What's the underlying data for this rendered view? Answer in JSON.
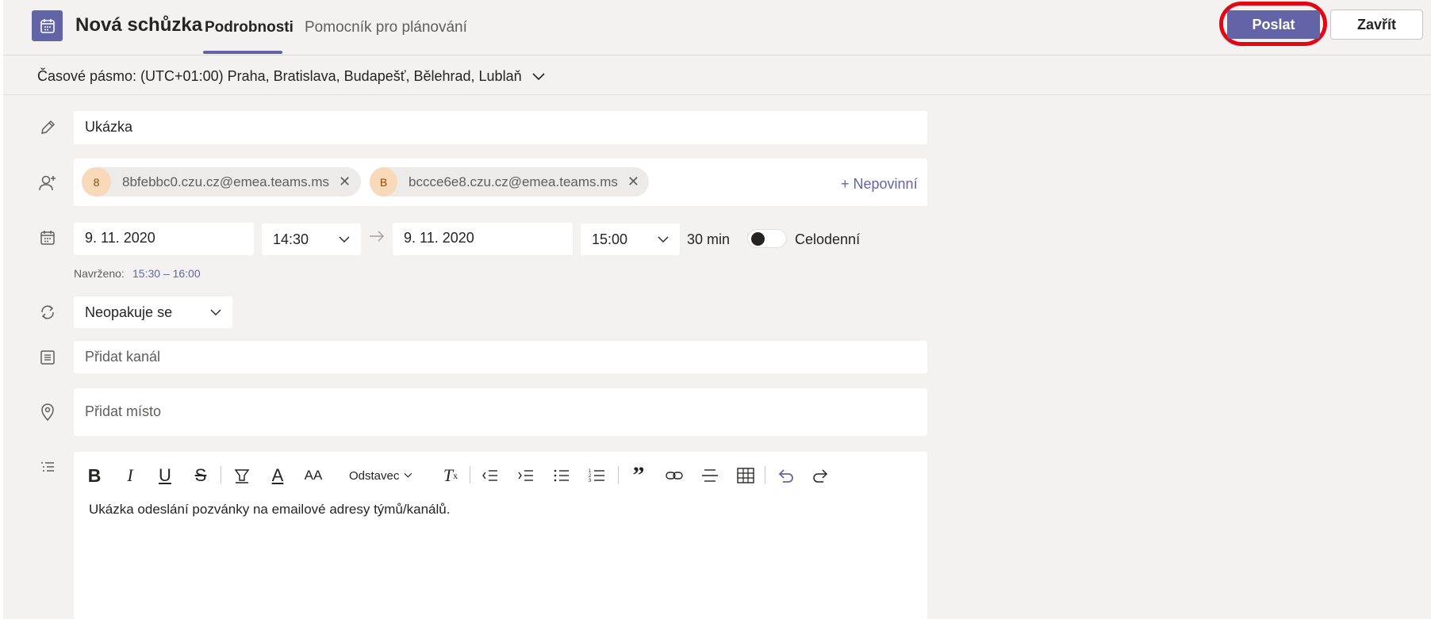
{
  "header": {
    "title": "Nová schůzka",
    "tabs": [
      {
        "label": "Podrobnosti",
        "active": true
      },
      {
        "label": "Pomocník pro plánování",
        "active": false
      }
    ],
    "send_label": "Poslat",
    "close_label": "Zavřít"
  },
  "timezone": {
    "label": "Časové pásmo: (UTC+01:00) Praha, Bratislava, Budapešť, Bělehrad, Lublaň"
  },
  "title_field": {
    "value": "Ukázka"
  },
  "attendees": {
    "chips": [
      {
        "initial": "8",
        "email": "8bfebbc0.czu.cz@emea.teams.ms"
      },
      {
        "initial": "B",
        "email": "bccce6e8.czu.cz@emea.teams.ms"
      }
    ],
    "optional_label": "+ Nepovinní"
  },
  "datetime": {
    "start_date": "9. 11. 2020",
    "start_time": "14:30",
    "end_date": "9. 11. 2020",
    "end_time": "15:00",
    "duration": "30 min",
    "all_day_label": "Celodenní",
    "all_day": false
  },
  "suggestion": {
    "label": "Navrženo:",
    "value": "15:30 – 16:00"
  },
  "recurrence": {
    "value": "Neopakuje se"
  },
  "channel": {
    "placeholder": "Přidat kanál"
  },
  "location": {
    "placeholder": "Přidat místo"
  },
  "editor": {
    "paragraph_label": "Odstavec",
    "body": "Ukázka odeslání pozvánky na emailové adresy týmů/kanálů."
  },
  "colors": {
    "accent": "#6264a7",
    "highlight_ring": "#e30613",
    "background": "#f3f2f1"
  }
}
